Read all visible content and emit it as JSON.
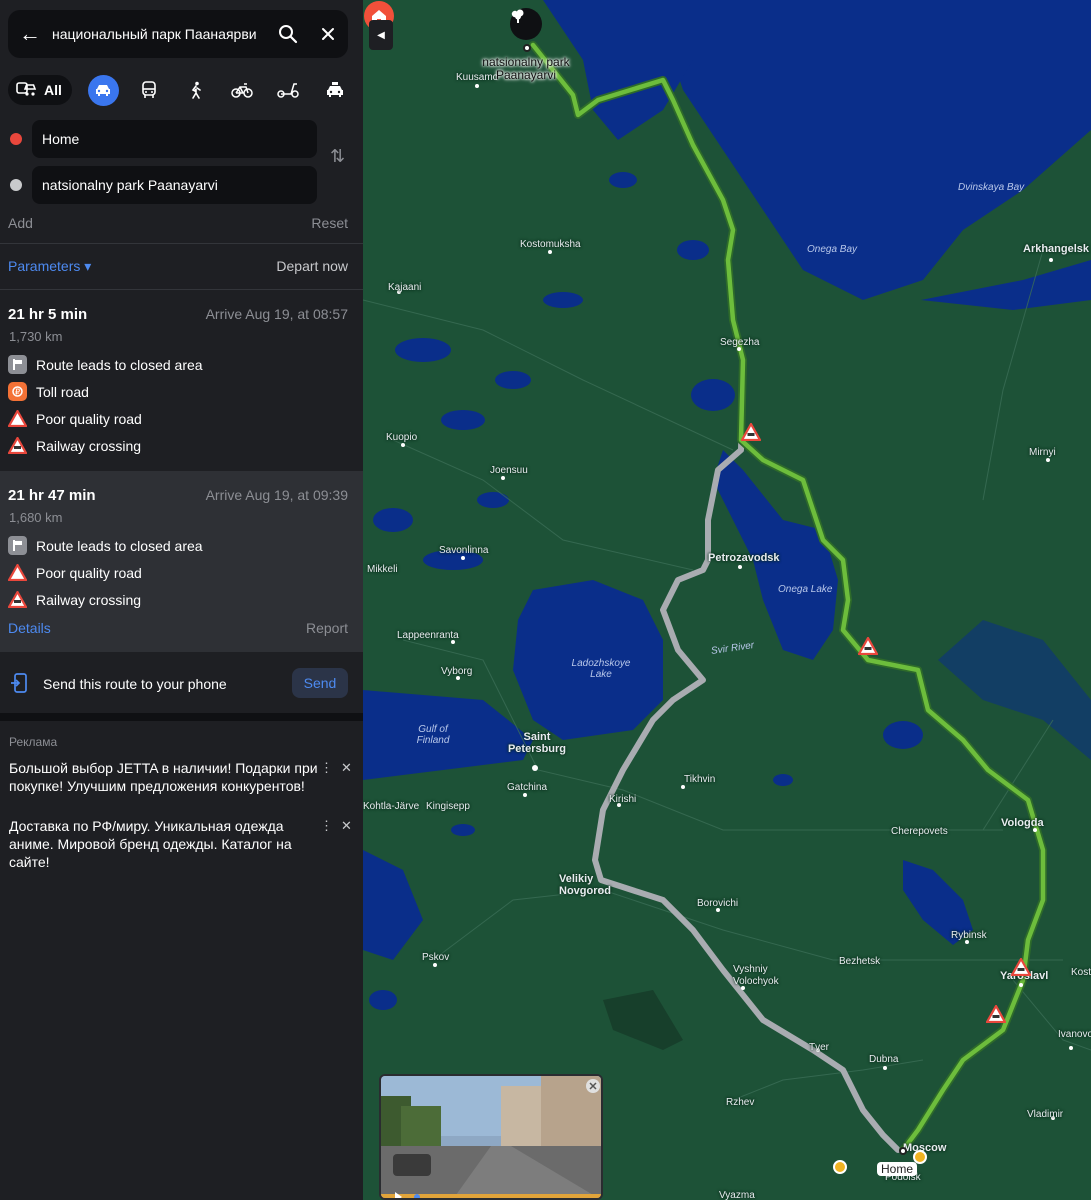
{
  "search": {
    "query": "национальный парк Паанаярви"
  },
  "modes": {
    "all_label": "All"
  },
  "waypoints": {
    "from": "Home",
    "to": "natsionalny park Paanayarvi"
  },
  "actions": {
    "add": "Add",
    "reset": "Reset",
    "parameters": "Parameters ▾",
    "depart": "Depart now"
  },
  "routes": [
    {
      "time": "21 hr 5 min",
      "arrive": "Arrive Aug 19, at 08:57",
      "distance": "1,730 km",
      "features": [
        "Route leads to closed area",
        "Toll road",
        "Poor quality road",
        "Railway crossing"
      ]
    },
    {
      "time": "21 hr 47 min",
      "arrive": "Arrive Aug 19, at 09:39",
      "distance": "1,680 km",
      "features": [
        "Route leads to closed area",
        "Poor quality road",
        "Railway crossing"
      ],
      "details": "Details",
      "report": "Report"
    }
  ],
  "send": {
    "text": "Send this route to your phone",
    "button": "Send"
  },
  "ads": {
    "label": "Реклама",
    "items": [
      "Большой выбор JETTA в наличии! Подарки при покупке! Улучшим предложения конкурентов!",
      "Доставка по РФ/миру. Уникальная одежда аниме. Мировой бренд одежды. Каталог на сайте!"
    ]
  },
  "map": {
    "destination": "natsionalny park Paanayarvi",
    "home": "Home",
    "cities": [
      "Kuusamo",
      "Kostomuksha",
      "Kajaani",
      "Segezha",
      "Kuopio",
      "Joensuu",
      "Savonlinna",
      "Mikkeli",
      "Petrozavodsk",
      "Lappeenranta",
      "Vyborg",
      "Saint Petersburg",
      "Gatchina",
      "Kirishi",
      "Tikhvin",
      "Kingisepp",
      "Kohtla-Järve",
      "Velikiy Novgorod",
      "Borovichi",
      "Pskov",
      "Vyshniy Volochyok",
      "Tver",
      "Rzhev",
      "Dubna",
      "Cherepovets",
      "Vologda",
      "Rybinsk",
      "Yaroslavl",
      "Bezhetsk",
      "Vladimir",
      "Ivanovo",
      "Arkhangelsk",
      "Mirnyi",
      "Moscow",
      "Podolsk",
      "Vyazma",
      "Kostroma"
    ],
    "water": [
      "Dvinskaya Bay",
      "Onega Bay",
      "Onega Lake",
      "Ladozhskoye Lake",
      "Gulf of Finland",
      "Svir River"
    ]
  },
  "colors": {
    "accent": "#4d8af0",
    "route_main": "#6dbd3c",
    "route_alt": "#a9acb1",
    "map_land": "#1d5237",
    "map_water": "#0a2e8a"
  }
}
